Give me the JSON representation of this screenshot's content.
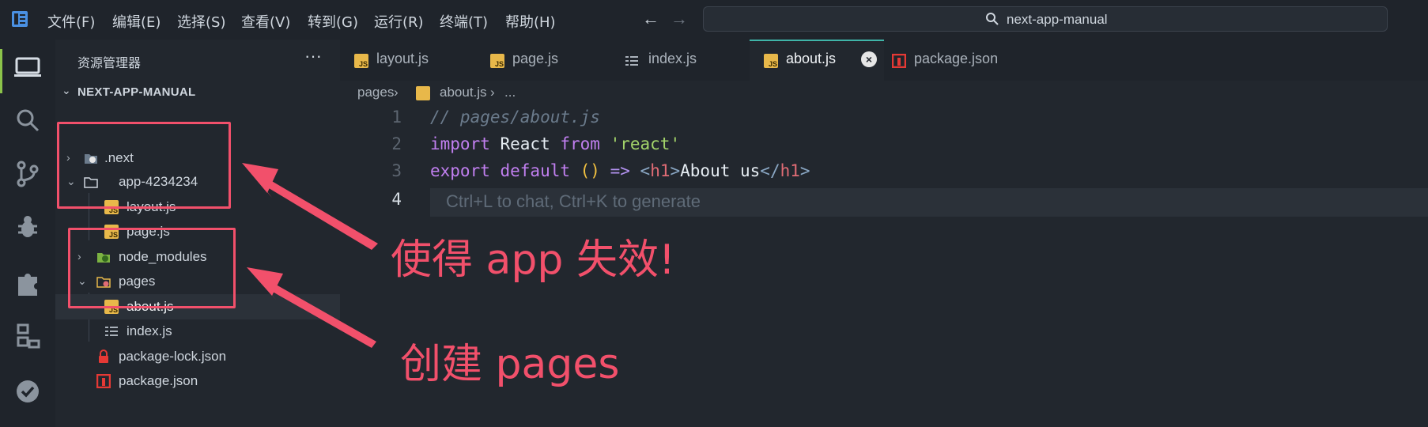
{
  "menu": {
    "items": [
      "文件(F)",
      "编辑(E)",
      "选择(S)",
      "查看(V)",
      "转到(G)",
      "运行(R)",
      "终端(T)",
      "帮助(H)"
    ]
  },
  "nav": {
    "back": "←",
    "forward": "→"
  },
  "command_center": {
    "text": "next-app-manual"
  },
  "sidebar": {
    "title": "资源管理器",
    "more": "···",
    "project": {
      "chevron": "⌄",
      "name": "NEXT-APP-MANUAL"
    },
    "tree": [
      {
        "label": ".next",
        "chevron": "›"
      },
      {
        "label": "app-4234234",
        "chevron": "⌄"
      },
      {
        "label": "layout.js",
        "icon": "JS"
      },
      {
        "label": "page.js",
        "icon": "JS"
      },
      {
        "label": "node_modules",
        "chevron": "›"
      },
      {
        "label": "pages",
        "chevron": "⌄"
      },
      {
        "label": "about.js",
        "icon": "JS"
      },
      {
        "label": "index.js"
      },
      {
        "label": "package-lock.json"
      },
      {
        "label": "package.json"
      }
    ]
  },
  "tabs": [
    {
      "label": "layout.js",
      "icon": "JS"
    },
    {
      "label": "page.js",
      "icon": "JS"
    },
    {
      "label": "index.js"
    },
    {
      "label": "about.js",
      "icon": "JS",
      "active": true
    },
    {
      "label": "package.json"
    }
  ],
  "tab_close": "×",
  "breadcrumb": {
    "folder": "pages",
    "sep": "›",
    "file": "about.js",
    "more": "..."
  },
  "editor": {
    "line_numbers": [
      "1",
      "2",
      "3",
      "4"
    ],
    "line1": {
      "comment": "// pages/about.js"
    },
    "line2": {
      "import": "import",
      "react_name": " React ",
      "from": "from",
      "str": " 'react'"
    },
    "line3": {
      "export": "export",
      "default": " default",
      "parens": " ()",
      "arrow": " =>",
      "lt": " <",
      "h1": "h1",
      "gt": ">",
      "text": "About us",
      "lt2": "</",
      "h1b": "h1",
      "gt2": ">"
    },
    "ai_hint": "Ctrl+L to chat, Ctrl+K to generate"
  },
  "annotations": {
    "note1": "使得 app 失效!",
    "note2": "创建 pages"
  },
  "colors": {
    "accent_red": "#f2506b",
    "active_tab_underline": "#3fb4a8",
    "js_icon": "#e8b84a"
  }
}
